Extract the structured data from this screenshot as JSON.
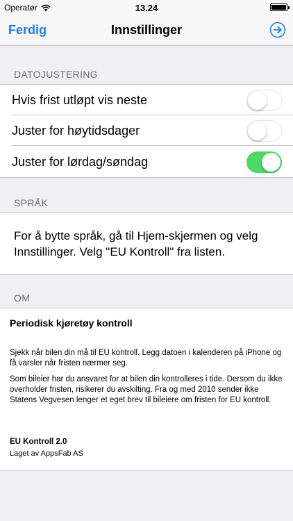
{
  "status_bar": {
    "carrier": "Operatør",
    "time": "13.24",
    "battery_level": 1.0
  },
  "nav": {
    "left_button": "Ferdig",
    "title": "Innstillinger",
    "right_icon": "forward-circle-icon"
  },
  "date_section": {
    "header": "DATOJUSTERING",
    "rows": [
      {
        "label": "Hvis frist utløpt vis neste",
        "on": false
      },
      {
        "label": "Juster for høytidsdager",
        "on": false
      },
      {
        "label": "Juster for lørdag/søndag",
        "on": true
      }
    ]
  },
  "language_section": {
    "header": "SPRÅK",
    "text": "For å bytte språk, gå til Hjem-skjermen og velg Innstillinger. Velg \"EU Kontroll\" fra listen."
  },
  "about_section": {
    "header": "OM",
    "title": "Periodisk kjøretøy kontroll",
    "paragraph1": "Sjekk når bilen din må til EU kontroll. Legg datoen i kalenderen på iPhone og få varsler når fristen nærmer seg.",
    "paragraph2": "Som bileier har du ansvaret for at bilen din kontrolleres i tide. Dersom du ikke overholder fristen, risikerer du avskilting. Fra og med 2010 sender ikke Statens Vegvesen lenger et eget brev til bileiere om fristen for EU kontroll.",
    "version": "EU Kontroll 2.0",
    "author": "Laget av AppsFab AS"
  },
  "colors": {
    "accent": "#1a7ee8",
    "toggle_on": "#4cd964",
    "background": "#efeff4"
  }
}
